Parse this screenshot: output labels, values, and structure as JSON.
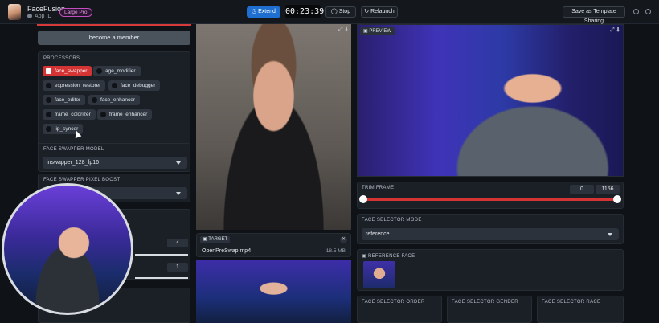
{
  "header": {
    "app_title": "FaceFusion",
    "app_id": "App ID",
    "plan_badge": "Large Pro",
    "extend_label": "Extend",
    "timer": "00:23:39",
    "stop_label": "Stop",
    "relaunch_label": "Relaunch",
    "template_label": "Save as Template Sharing"
  },
  "left": {
    "member_button": "become a member",
    "processors": {
      "label": "PROCESSORS",
      "items": [
        {
          "label": "face_swapper",
          "checked": true
        },
        {
          "label": "age_modifier",
          "checked": false
        },
        {
          "label": "expression_restorer",
          "checked": false
        },
        {
          "label": "face_debugger",
          "checked": false
        },
        {
          "label": "face_editor",
          "checked": false
        },
        {
          "label": "face_enhancer",
          "checked": false
        },
        {
          "label": "frame_colorizer",
          "checked": false
        },
        {
          "label": "frame_enhancer",
          "checked": false
        },
        {
          "label": "lip_syncer",
          "checked": false
        }
      ]
    },
    "face_swapper_model": {
      "label": "FACE SWAPPER MODEL",
      "value": "inswapper_128_fp16"
    },
    "face_swapper_pixel_boost": {
      "label": "FACE SWAPPER PIXEL BOOST"
    },
    "number_a": "4",
    "number_b": "1"
  },
  "center": {
    "target_label": "TARGET",
    "target_file": "OpenPreSwap.mp4",
    "target_size": "18.5 MB"
  },
  "right": {
    "preview_label": "PREVIEW",
    "trim_frame": {
      "label": "TRIM FRAME",
      "start": "0",
      "end": "1156"
    },
    "face_selector_mode": {
      "label": "FACE SELECTOR MODE",
      "value": "reference"
    },
    "reference_face_label": "REFERENCE FACE",
    "face_selector_order_label": "FACE SELECTOR ORDER",
    "face_selector_gender_label": "FACE SELECTOR GENDER",
    "face_selector_race_label": "FACE SELECTOR RACE"
  },
  "colors": {
    "accent_red": "#d43434",
    "accent_blue": "#1f6fd1",
    "panel_bg": "#1b2027"
  }
}
